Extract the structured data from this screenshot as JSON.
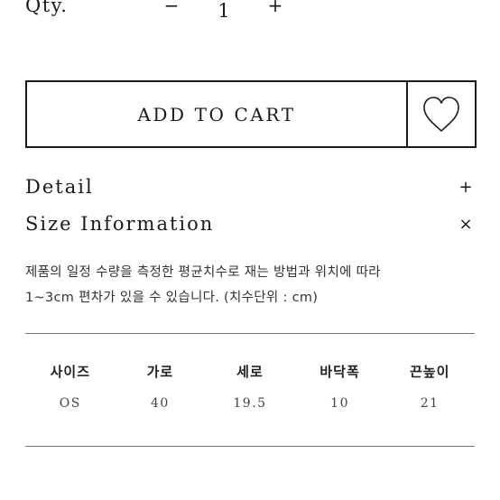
{
  "quantity": {
    "label": "Qty.",
    "minus": "−",
    "value": "1",
    "plus": "+"
  },
  "cart": {
    "add_label": "ADD TO CART",
    "wishlist_icon": "heart-outline-icon"
  },
  "accordion": [
    {
      "title": "Detail",
      "toggle": "+",
      "expanded": false
    },
    {
      "title": "Size Information",
      "toggle": "×",
      "expanded": true
    }
  ],
  "size_info": {
    "description": [
      "제품의 일정 수량을 측정한 평균치수로 재는 방법과 위치에 따라",
      "1~3cm 편차가 있을 수 있습니다. (치수단위 : cm)"
    ],
    "headers": [
      "사이즈",
      "가로",
      "세로",
      "바닥폭",
      "끈높이"
    ],
    "rows": [
      [
        "OS",
        "40",
        "19.5",
        "10",
        "21"
      ]
    ]
  },
  "colors": {
    "text": "#1a1a1a",
    "border": "#1a1a1a",
    "rule": "#7a7a7a",
    "background": "#ffffff"
  }
}
